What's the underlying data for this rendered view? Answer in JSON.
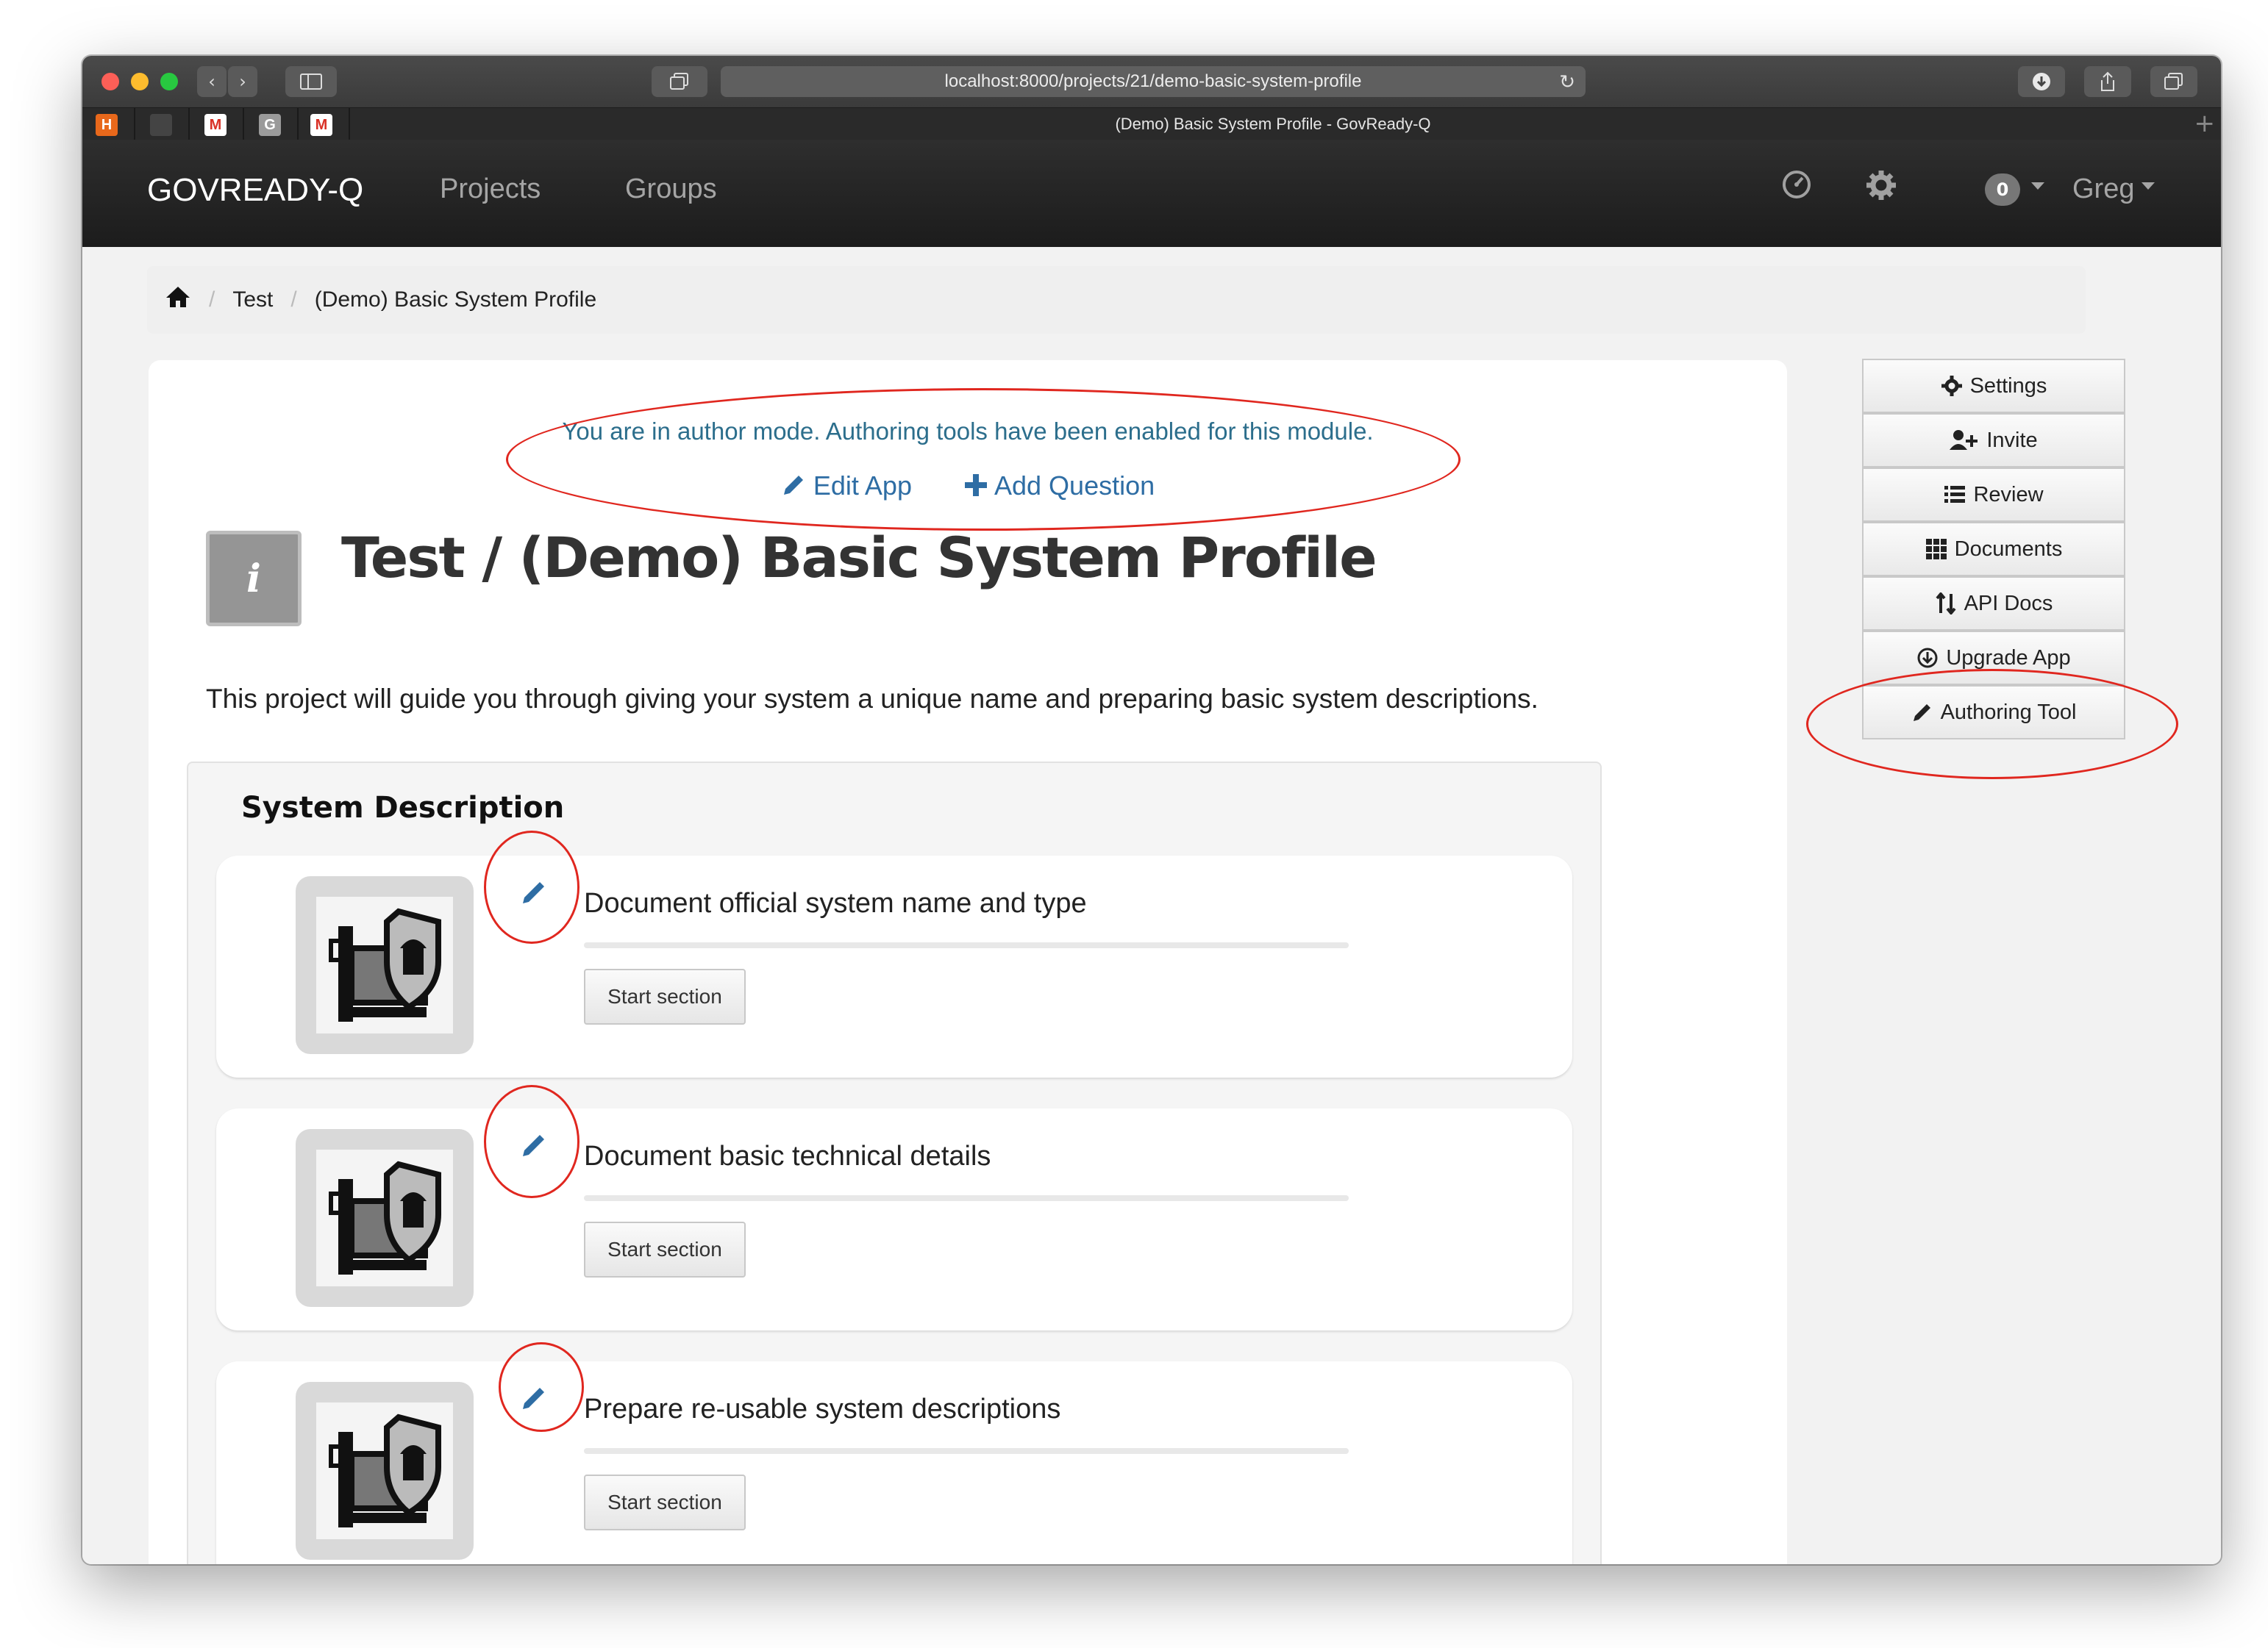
{
  "browser": {
    "url": "localhost:8000/projects/21/demo-basic-system-profile",
    "tab_title": "(Demo) Basic System Profile - GovReady-Q",
    "favicons": [
      "H",
      "",
      "M",
      "G",
      "M"
    ]
  },
  "navbar": {
    "brand": "GOVREADY-Q",
    "links": [
      "Projects",
      "Groups"
    ],
    "notification_count": "0",
    "user": "Greg"
  },
  "breadcrumb": {
    "items": [
      "Test",
      "(Demo) Basic System Profile"
    ]
  },
  "author_mode": {
    "message": "You are in author mode. Authoring tools have been enabled for this module.",
    "edit_app": "Edit App",
    "add_question": "Add Question"
  },
  "project": {
    "icon_letter": "i",
    "title": "Test / (Demo) Basic System Profile",
    "intro": "This project will guide you through giving your system a unique name and preparing basic system descriptions."
  },
  "section": {
    "heading": "System Description",
    "tasks": [
      {
        "title": "Document official system name and type",
        "button": "Start section",
        "progress": 0
      },
      {
        "title": "Document basic technical details",
        "button": "Start section",
        "progress": 0
      },
      {
        "title": "Prepare re-usable system descriptions",
        "button": "Start section",
        "progress": 0
      }
    ]
  },
  "sidebar": {
    "buttons": [
      "Settings",
      "Invite",
      "Review",
      "Documents",
      "API Docs",
      "Upgrade App",
      "Authoring Tool"
    ]
  },
  "colors": {
    "annotation": "#e0271f",
    "link": "#2e6da4",
    "author_text": "#2c6e8c"
  }
}
